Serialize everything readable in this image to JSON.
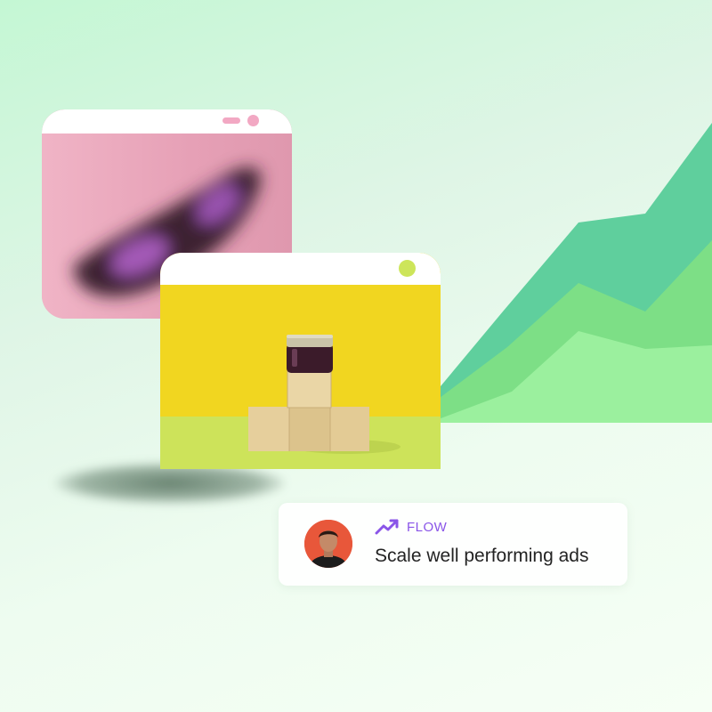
{
  "card": {
    "tag": "FLOW",
    "headline": "Scale well performing ads"
  },
  "colors": {
    "background": "#dff5e6",
    "chart_dark": "#5fcf9d",
    "chart_mid": "#7ddf86",
    "chart_light": "#9bf09e",
    "pink_window": "#e8a4b6",
    "yellow_window": "#f1d620",
    "accent_purple": "#8a55e8",
    "window_dot_green": "#cde55a",
    "window_pill_pink": "#f2a8c3"
  },
  "icons": {
    "trend": "trending-up-icon"
  }
}
